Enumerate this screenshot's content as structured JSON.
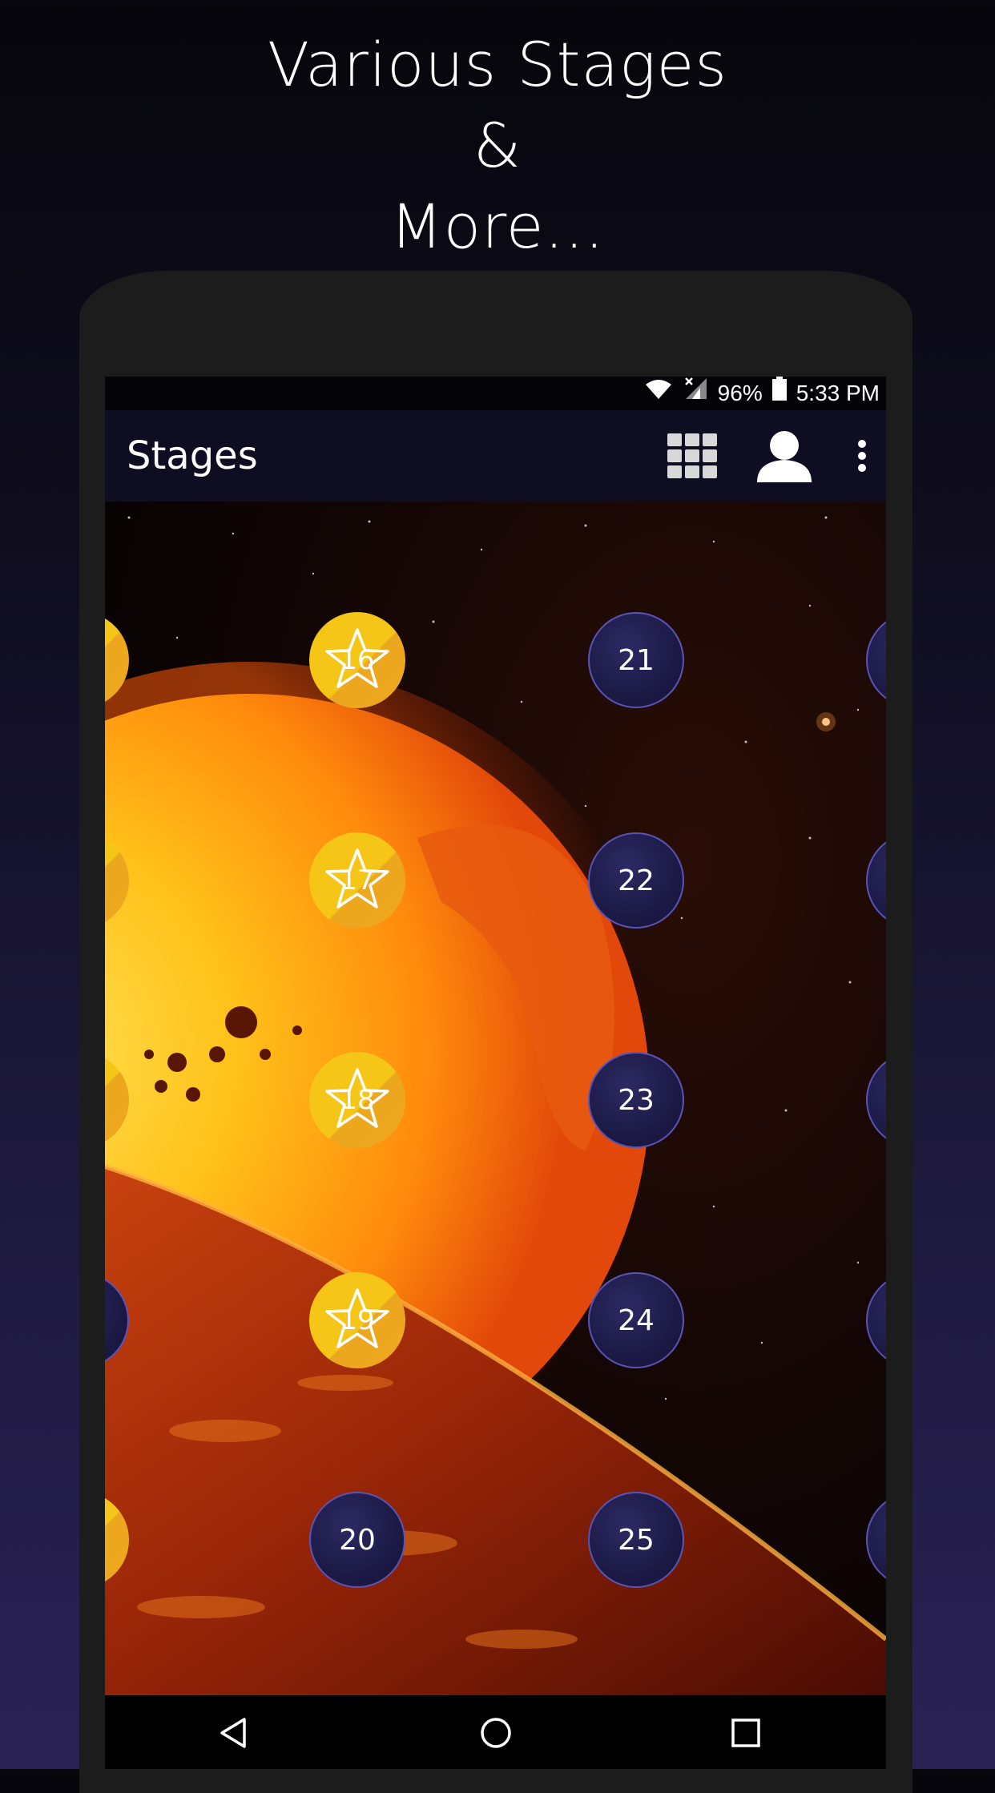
{
  "headline": {
    "line1": "Various Stages",
    "line2": "&",
    "line3": "More..."
  },
  "status_bar": {
    "battery": "96%",
    "time": "5:33 PM",
    "icons": [
      "wifi-icon",
      "no-signal-icon",
      "battery-icon"
    ]
  },
  "app_bar": {
    "title": "Stages",
    "actions": [
      "grid-icon",
      "profile-icon",
      "more-vert-icon"
    ]
  },
  "stages": {
    "column1": [
      {
        "label": "16",
        "state": "completed"
      },
      {
        "label": "17",
        "state": "completed"
      },
      {
        "label": "18",
        "state": "completed"
      },
      {
        "label": "19",
        "state": "completed"
      },
      {
        "label": "20",
        "state": "locked"
      }
    ],
    "column2": [
      {
        "label": "21",
        "state": "locked"
      },
      {
        "label": "22",
        "state": "locked"
      },
      {
        "label": "23",
        "state": "locked"
      },
      {
        "label": "24",
        "state": "locked"
      },
      {
        "label": "25",
        "state": "locked"
      }
    ]
  },
  "nav_bar": {
    "icons": [
      "back-icon",
      "home-icon",
      "recents-icon"
    ]
  },
  "colors": {
    "completed": "#f5c518",
    "locked": "#1c1a45",
    "locked_border": "#5a53b8",
    "app_bar": "#0e0d22"
  }
}
